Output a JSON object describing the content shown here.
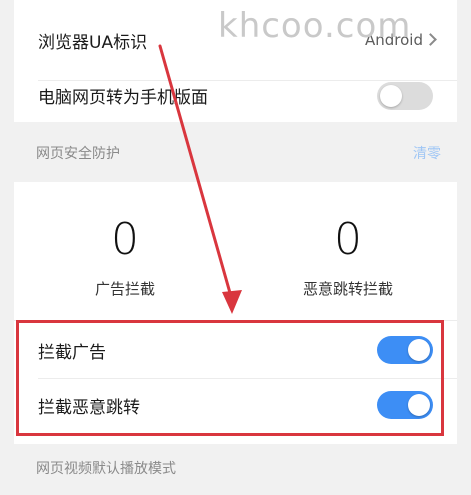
{
  "watermark": "khcoo.com",
  "settings": {
    "ua_label": "浏览器UA标识",
    "ua_value": "Android",
    "desktop_to_mobile_label": "电脑网页转为手机版面",
    "desktop_to_mobile_on": false
  },
  "security": {
    "section_title": "网页安全防护",
    "clear_label": "清零",
    "ads_blocked_count": "0",
    "ads_blocked_label": "广告拦截",
    "redirects_blocked_count": "0",
    "redirects_blocked_label": "恶意跳转拦截",
    "block_ads_label": "拦截广告",
    "block_ads_on": true,
    "block_redirects_label": "拦截恶意跳转",
    "block_redirects_on": true
  },
  "video": {
    "section_title": "网页视频默认播放模式"
  },
  "colors": {
    "toggle_on": "#3d8ef5",
    "toggle_off": "#dcdcdc",
    "annotation": "#d9363e",
    "clear_link": "#9fc6f5"
  }
}
